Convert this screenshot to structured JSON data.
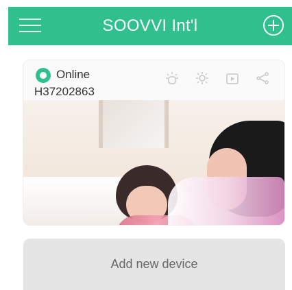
{
  "header": {
    "title": "SOOVVI Int'l",
    "menu_icon": "hamburger-menu-icon",
    "add_icon": "plus-circle-icon",
    "color": "#2fc08e"
  },
  "device": {
    "status": "Online",
    "id": "H37202863",
    "status_icon": "online-status-icon",
    "tools": [
      {
        "icon": "alarm-icon"
      },
      {
        "icon": "settings-icon"
      },
      {
        "icon": "playback-icon"
      },
      {
        "icon": "share-icon"
      }
    ]
  },
  "actions": {
    "add_new_device_label": "Add new device"
  }
}
